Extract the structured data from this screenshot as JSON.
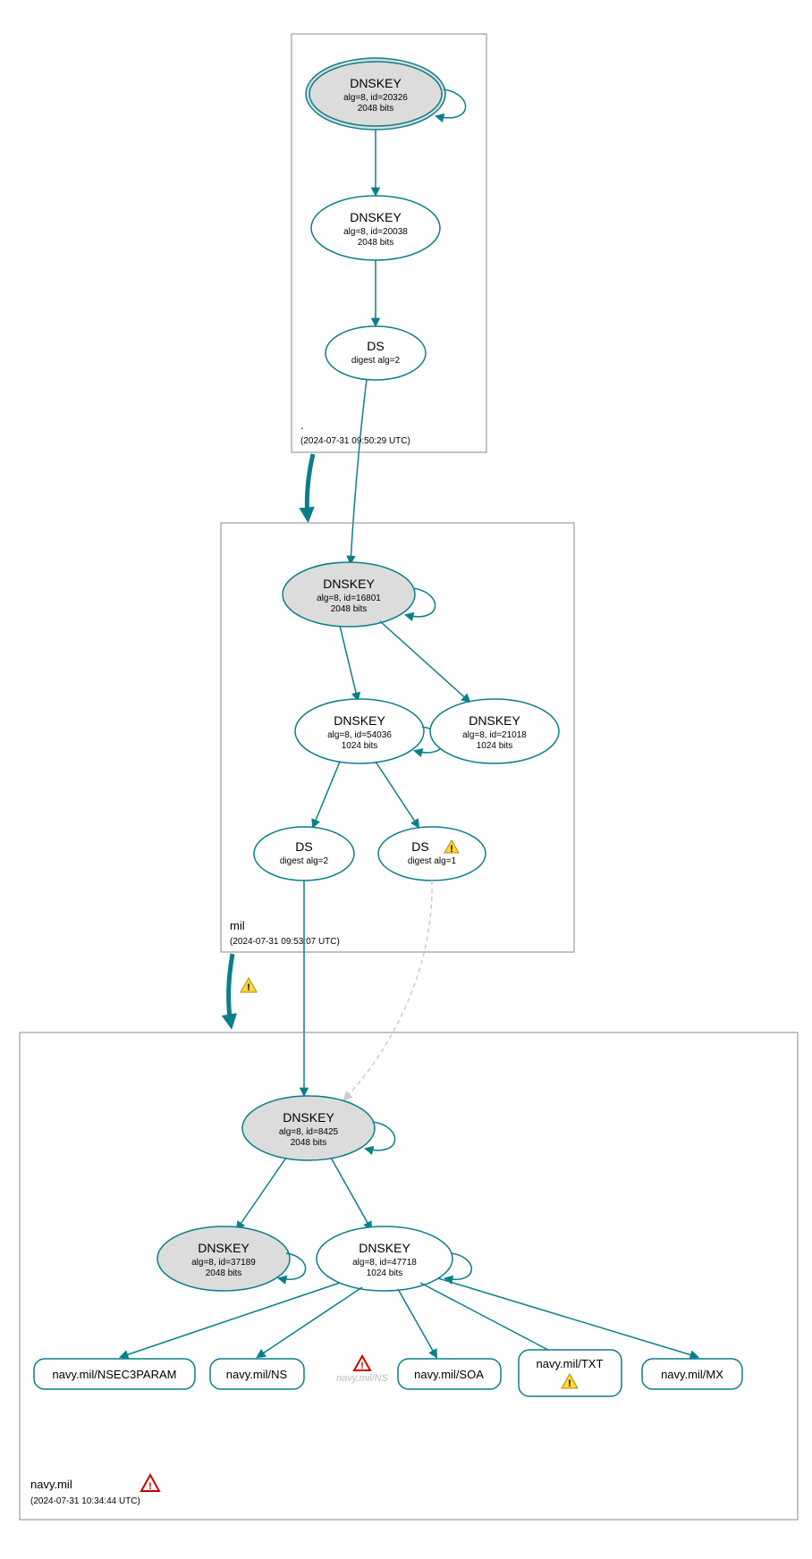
{
  "color_edge": "#0a7f8a",
  "zones": {
    "root": {
      "name": ".",
      "timestamp": "(2024-07-31 09:50:29 UTC)"
    },
    "mil": {
      "name": "mil",
      "timestamp": "(2024-07-31 09:53:07 UTC)"
    },
    "navy": {
      "name": "navy.mil",
      "timestamp": "(2024-07-31 10:34:44 UTC)"
    }
  },
  "nodes": {
    "root_ksk": {
      "title": "DNSKEY",
      "line2": "alg=8, id=20326",
      "line3": "2048 bits"
    },
    "root_zsk": {
      "title": "DNSKEY",
      "line2": "alg=8, id=20038",
      "line3": "2048 bits"
    },
    "root_ds": {
      "title": "DS",
      "line2": "digest alg=2"
    },
    "mil_ksk": {
      "title": "DNSKEY",
      "line2": "alg=8, id=16801",
      "line3": "2048 bits"
    },
    "mil_zsk": {
      "title": "DNSKEY",
      "line2": "alg=8, id=54036",
      "line3": "1024 bits"
    },
    "mil_zsk2": {
      "title": "DNSKEY",
      "line2": "alg=8, id=21018",
      "line3": "1024 bits"
    },
    "mil_ds1": {
      "title": "DS",
      "line2": "digest alg=2"
    },
    "mil_ds2": {
      "title": "DS",
      "line2": "digest alg=1"
    },
    "navy_ksk": {
      "title": "DNSKEY",
      "line2": "alg=8, id=8425",
      "line3": "2048 bits"
    },
    "navy_ksk2": {
      "title": "DNSKEY",
      "line2": "alg=8, id=37189",
      "line3": "2048 bits"
    },
    "navy_zsk": {
      "title": "DNSKEY",
      "line2": "alg=8, id=47718",
      "line3": "1024 bits"
    }
  },
  "rrsets": {
    "nsec3": "navy.mil/NSEC3PARAM",
    "ns": "navy.mil/NS",
    "ns_gray": "navy.mil/NS",
    "soa": "navy.mil/SOA",
    "txt": "navy.mil/TXT",
    "mx": "navy.mil/MX"
  }
}
